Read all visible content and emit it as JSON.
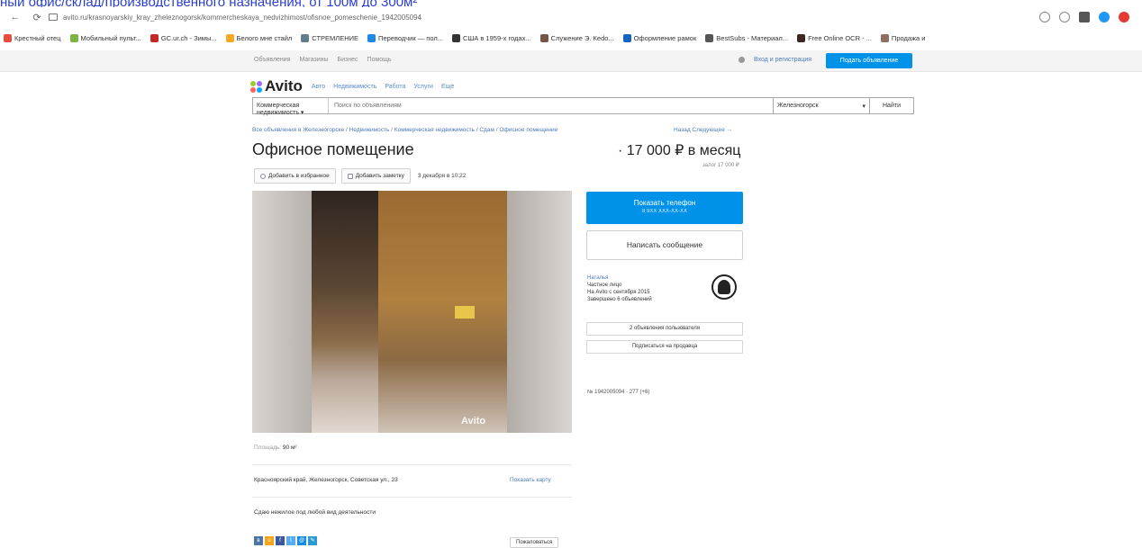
{
  "browser": {
    "page_link_text": "ный офис/склад/производственного назначения, от 100м до 300м²",
    "url": "avito.ru/krasnoyarskiy_kray_zheleznogorsk/kommercheskaya_nedvizhimost/ofisnoe_pomeschenie_1942005094",
    "bookmarks": [
      {
        "label": "Крестный отец",
        "color": "#e74c3c"
      },
      {
        "label": "Мобильный пульт...",
        "color": "#7cb342"
      },
      {
        "label": "GC.ur.ch - Зимы...",
        "color": "#c62828"
      },
      {
        "label": "Белого мне стайл",
        "color": "#f9a825"
      },
      {
        "label": "СТРЕМЛЕНИЕ",
        "color": "#607d8b"
      },
      {
        "label": "Переводчик — пол...",
        "color": "#1e88e5"
      },
      {
        "label": "США в 1959-х годах...",
        "color": "#333333"
      },
      {
        "label": "Служение Э. Кеdo...",
        "color": "#795548"
      },
      {
        "label": "Оформление рамок",
        "color": "#1565c0"
      },
      {
        "label": "BestSubs - Материал...",
        "color": "#555555"
      },
      {
        "label": "Free Online OCR - ...",
        "color": "#3e2723"
      },
      {
        "label": "Продажа и",
        "color": "#8d6e63"
      }
    ]
  },
  "site_top": {
    "menu": [
      "Объявления",
      "Магазины",
      "Бизнес",
      "Помощь"
    ],
    "login": "Вход и регистрация",
    "post_ad": "Подать объявление"
  },
  "logo": {
    "text": "Avito"
  },
  "logo_nav": [
    "Авто",
    "Недвижимость",
    "Работа",
    "Услуги",
    "Ещё"
  ],
  "search": {
    "category": "Коммерческая недвижимость",
    "placeholder": "Поиск по объявлениям",
    "city": "Железногорск",
    "find": "Найти"
  },
  "breadcrumbs": "Все объявления в Железногорске / Недвижимость / Коммерческая недвижимость / Сдам / Офисное помещение",
  "breadcrumbs_right": "Назад  Следующее →",
  "listing": {
    "title": "Офисное помещение",
    "price": "17 000 ₽ в месяц",
    "price_sub": "залог 17 000 ₽",
    "add_favorite": "Добавить в избранное",
    "add_note": "Добавить заметку",
    "date": "3 декабря в 10:22",
    "photo_watermark": "Avito",
    "area_label": "Площадь:",
    "area_value": "90 м²",
    "address": "Красноярский край, Железногорск, Советская ул., 23",
    "show_map": "Показать карту",
    "description": "Сдаю нежилое под любой вид деятельности",
    "complain": "Пожаловаться"
  },
  "contact": {
    "phone_btn": "Показать телефон",
    "phone_masked": "8 9XX XXX-XX-XX",
    "message_btn": "Написать сообщение"
  },
  "seller": {
    "name": "Наталья",
    "type": "Частное лицо",
    "since": "На Avito с сентября 2015",
    "completed": "Завершено 6 объявлений",
    "all_ads": "2 объявления пользователя",
    "subscribe": "Подписаться на продавца"
  },
  "ad_id": "№ 1942005094  ·  277 (+6)"
}
